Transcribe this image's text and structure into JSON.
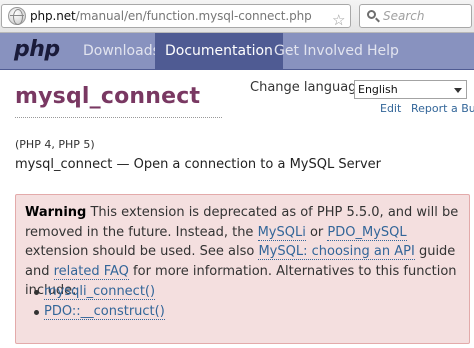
{
  "browser": {
    "url_host": "php.net",
    "url_path": "/manual/en/function.mysql-connect.php",
    "search_placeholder": "Search"
  },
  "nav": {
    "logo": "php",
    "items": [
      {
        "label": "Downloads",
        "active": false
      },
      {
        "label": "Documentation",
        "active": true
      },
      {
        "label": "Get Involved",
        "active": false
      },
      {
        "label": "Help",
        "active": false
      }
    ]
  },
  "page": {
    "title": "mysql_connect",
    "change_language_label": "Change language:",
    "language_selected": "English",
    "edit_link": "Edit",
    "report_bug_link": "Report a Bug",
    "versions": "(PHP 4, PHP 5)",
    "refpurpose": "mysql_connect — Open a connection to a MySQL Server"
  },
  "warning": {
    "heading": "Warning",
    "text_1": "This extension is deprecated as of PHP 5.5.0, and will be removed in the future. Instead, the",
    "link_mysqli": "MySQLi",
    "text_2": "or",
    "link_pdo_mysql": "PDO_MySQL",
    "text_3": "extension should be used. See also",
    "link_choosing_api": "MySQL: choosing an API",
    "text_4": "guide and",
    "link_related_faq": "related FAQ",
    "text_5": "for more information. Alternatives to this function include:",
    "alternatives": [
      "mysqli_connect()",
      "PDO::__construct()"
    ]
  }
}
